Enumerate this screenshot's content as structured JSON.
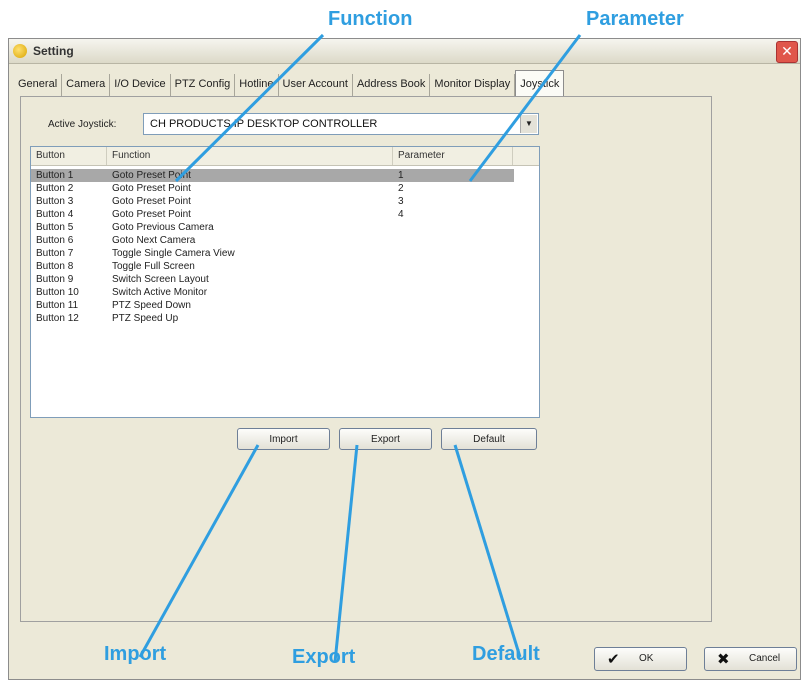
{
  "window": {
    "title": "Setting"
  },
  "tabs": [
    "General",
    "Camera",
    "I/O Device",
    "PTZ Config",
    "Hotline",
    "User Account",
    "Address Book",
    "Monitor Display",
    "Joystick"
  ],
  "joystick": {
    "label": "Active Joystick:",
    "selected": "CH PRODUCTS IP DESKTOP CONTROLLER",
    "columns": {
      "button": "Button",
      "function": "Function",
      "parameter": "Parameter"
    },
    "rows": [
      {
        "button": "Button 1",
        "function": "Goto Preset Point",
        "parameter": "1"
      },
      {
        "button": "Button 2",
        "function": "Goto Preset Point",
        "parameter": "2"
      },
      {
        "button": "Button 3",
        "function": "Goto Preset Point",
        "parameter": "3"
      },
      {
        "button": "Button 4",
        "function": "Goto Preset Point",
        "parameter": "4"
      },
      {
        "button": "Button 5",
        "function": "Goto Previous Camera",
        "parameter": ""
      },
      {
        "button": "Button 6",
        "function": "Goto Next Camera",
        "parameter": ""
      },
      {
        "button": "Button 7",
        "function": "Toggle Single Camera View",
        "parameter": ""
      },
      {
        "button": "Button 8",
        "function": "Toggle Full Screen",
        "parameter": ""
      },
      {
        "button": "Button 9",
        "function": "Switch Screen Layout",
        "parameter": ""
      },
      {
        "button": "Button 10",
        "function": "Switch Active Monitor",
        "parameter": ""
      },
      {
        "button": "Button 11",
        "function": "PTZ Speed Down",
        "parameter": ""
      },
      {
        "button": "Button 12",
        "function": "PTZ Speed Up",
        "parameter": ""
      }
    ],
    "selected_row": 0,
    "import_label": "Import",
    "export_label": "Export",
    "default_label": "Default"
  },
  "footer": {
    "ok_label": "OK",
    "cancel_label": "Cancel"
  },
  "callouts": {
    "function": "Function",
    "parameter": "Parameter",
    "import": "Import",
    "export": "Export",
    "default": "Default",
    "color": "#2f9ee0"
  }
}
